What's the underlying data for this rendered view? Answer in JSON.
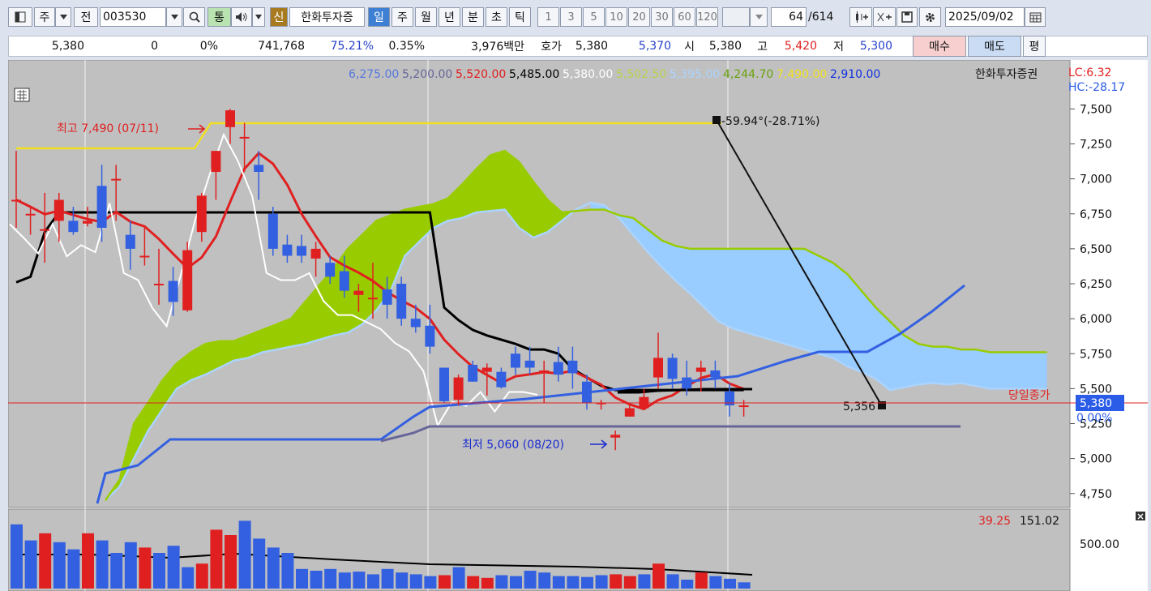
{
  "toolbar": {
    "type_label": "주",
    "prev_label": "전",
    "code": "003530",
    "tong_label": "통",
    "sin_label": "신",
    "company": "한화투자증",
    "periods": [
      "일",
      "주",
      "월",
      "년",
      "분",
      "초",
      "틱"
    ],
    "minutes": [
      "1",
      "3",
      "5",
      "10",
      "20",
      "30",
      "60",
      "120"
    ],
    "count": "64",
    "total": "/614",
    "date": "2025/09/02"
  },
  "quote": {
    "price": "5,380",
    "change": "0",
    "change_pct": "0%",
    "volume": "741,768",
    "vol_ratio": "75.21%",
    "turnover": "0.35%",
    "amount": "3,976백만",
    "hoga_label": "호가",
    "hoga": "5,380",
    "ask": "5,370",
    "open_label": "시",
    "open": "5,380",
    "high_label": "고",
    "high": "5,420",
    "low_label": "저",
    "low": "5,300",
    "buy_label": "매수",
    "sell_label": "매도",
    "eval_label": "평"
  },
  "legend": {
    "items": [
      {
        "text": "6,275.00",
        "color": "#5577dd"
      },
      {
        "text": "5,200.00",
        "color": "#666699"
      },
      {
        "text": "5,520.00",
        "color": "#e02020"
      },
      {
        "text": "5,485.00",
        "color": "#000000"
      },
      {
        "text": "5,380.00",
        "color": "#ffffff"
      },
      {
        "text": "5,502.50",
        "color": "#b7d34a"
      },
      {
        "text": "5,395.00",
        "color": "#aad4ff"
      },
      {
        "text": "4,244.70",
        "color": "#6aa20c"
      },
      {
        "text": "7,490.00",
        "color": "#f0e020"
      },
      {
        "text": "2,910.00",
        "color": "#1030e0"
      }
    ],
    "name": "한화투자증권",
    "lc": "LC:6.32",
    "hc": "HC:-28.17"
  },
  "annotations": {
    "high": "최고 7,490 (07/11)",
    "low": "최저 5,060 (08/20)",
    "trend": "-59.94°(-28.71%)",
    "target": "5,356",
    "close_label": "당일종가",
    "price_box": "5,380",
    "pct_box": "0.00%"
  },
  "volume_legend": {
    "a": "39.25",
    "b": "151.02",
    "axis": "500.00"
  },
  "colors": {
    "up": "#e02020",
    "down": "#3360e0",
    "cloud_green": "#99cc00",
    "cloud_blue": "#99ccff",
    "panel": "#c0c0c0"
  },
  "chart_data": {
    "type": "candlestick",
    "ylim": [
      4650,
      7850
    ],
    "yticks": [
      "7,500",
      "7,250",
      "7,000",
      "6,750",
      "6,500",
      "6,250",
      "6,000",
      "5,750",
      "5,500",
      "5,250",
      "5,000",
      "4,750"
    ],
    "candles": [
      [
        6850,
        6850,
        6650,
        7200
      ],
      [
        6750,
        6750,
        6600,
        6800
      ],
      [
        6640,
        6640,
        6400,
        6900
      ],
      [
        6700,
        6850,
        6550,
        6900
      ],
      [
        6700,
        6620,
        6600,
        6800
      ],
      [
        6680,
        6700,
        6660,
        6800
      ],
      [
        6950,
        6650,
        6550,
        7100
      ],
      [
        7000,
        7000,
        6700,
        7100
      ],
      [
        6600,
        6500,
        6350,
        6700
      ],
      [
        6450,
        6450,
        6380,
        6650
      ],
      [
        6250,
        6250,
        6100,
        6500
      ],
      [
        6270,
        6120,
        6020,
        6370
      ],
      [
        6060,
        6490,
        6050,
        6550
      ],
      [
        6620,
        6880,
        6550,
        6900
      ],
      [
        7050,
        7200,
        6850,
        7200
      ],
      [
        7370,
        7490,
        7250,
        7500
      ],
      [
        7300,
        7300,
        7050,
        7400
      ],
      [
        7100,
        7050,
        6850,
        7200
      ],
      [
        6750,
        6500,
        6450,
        6800
      ],
      [
        6530,
        6450,
        6400,
        6600
      ],
      [
        6520,
        6450,
        6400,
        6600
      ],
      [
        6430,
        6500,
        6300,
        6550
      ],
      [
        6400,
        6300,
        6250,
        6450
      ],
      [
        6340,
        6200,
        6150,
        6450
      ],
      [
        6170,
        6200,
        6050,
        6250
      ],
      [
        6150,
        6150,
        6000,
        6400
      ],
      [
        6210,
        6100,
        6000,
        6300
      ],
      [
        6250,
        6000,
        5950,
        6300
      ],
      [
        6000,
        5940,
        5900,
        6100
      ],
      [
        5950,
        5800,
        5750,
        6100
      ],
      [
        5650,
        5410,
        5400,
        5650
      ],
      [
        5420,
        5580,
        5380,
        5600
      ],
      [
        5670,
        5550,
        5550,
        5700
      ],
      [
        5620,
        5650,
        5450,
        5680
      ],
      [
        5620,
        5510,
        5500,
        5650
      ],
      [
        5750,
        5650,
        5600,
        5800
      ],
      [
        5700,
        5650,
        5600,
        5800
      ],
      [
        5610,
        5630,
        5400,
        5700
      ],
      [
        5690,
        5600,
        5550,
        5800
      ],
      [
        5700,
        5610,
        5500,
        5800
      ],
      [
        5550,
        5400,
        5350,
        5600
      ],
      [
        5390,
        5400,
        5350,
        5420
      ],
      [
        5150,
        5170,
        5060,
        5200
      ],
      [
        5300,
        5360,
        5300,
        5400
      ],
      [
        5360,
        5440,
        5350,
        5500
      ],
      [
        5580,
        5720,
        5500,
        5900
      ],
      [
        5720,
        5570,
        5500,
        5750
      ],
      [
        5580,
        5500,
        5450,
        5700
      ],
      [
        5620,
        5650,
        5480,
        5700
      ],
      [
        5630,
        5580,
        5500,
        5700
      ],
      [
        5480,
        5380,
        5300,
        5540
      ],
      [
        5380,
        5380,
        5300,
        5420
      ]
    ],
    "volume": [
      [
        360,
        0
      ],
      [
        270,
        0
      ],
      [
        310,
        1
      ],
      [
        260,
        0
      ],
      [
        220,
        0
      ],
      [
        310,
        1
      ],
      [
        270,
        0
      ],
      [
        200,
        0
      ],
      [
        260,
        0
      ],
      [
        230,
        1
      ],
      [
        200,
        0
      ],
      [
        240,
        0
      ],
      [
        120,
        0
      ],
      [
        140,
        1
      ],
      [
        330,
        1
      ],
      [
        300,
        1
      ],
      [
        380,
        0
      ],
      [
        280,
        0
      ],
      [
        230,
        0
      ],
      [
        200,
        0
      ],
      [
        110,
        0
      ],
      [
        100,
        0
      ],
      [
        110,
        0
      ],
      [
        90,
        0
      ],
      [
        95,
        0
      ],
      [
        80,
        0
      ],
      [
        110,
        0
      ],
      [
        90,
        0
      ],
      [
        80,
        0
      ],
      [
        70,
        0
      ],
      [
        75,
        1
      ],
      [
        120,
        0
      ],
      [
        70,
        1
      ],
      [
        60,
        1
      ],
      [
        75,
        0
      ],
      [
        70,
        0
      ],
      [
        100,
        0
      ],
      [
        90,
        0
      ],
      [
        70,
        0
      ],
      [
        70,
        0
      ],
      [
        65,
        0
      ],
      [
        75,
        0
      ],
      [
        80,
        1
      ],
      [
        70,
        1
      ],
      [
        80,
        0
      ],
      [
        140,
        1
      ],
      [
        80,
        0
      ],
      [
        50,
        0
      ],
      [
        90,
        1
      ],
      [
        70,
        0
      ],
      [
        55,
        0
      ],
      [
        35,
        0
      ]
    ]
  }
}
